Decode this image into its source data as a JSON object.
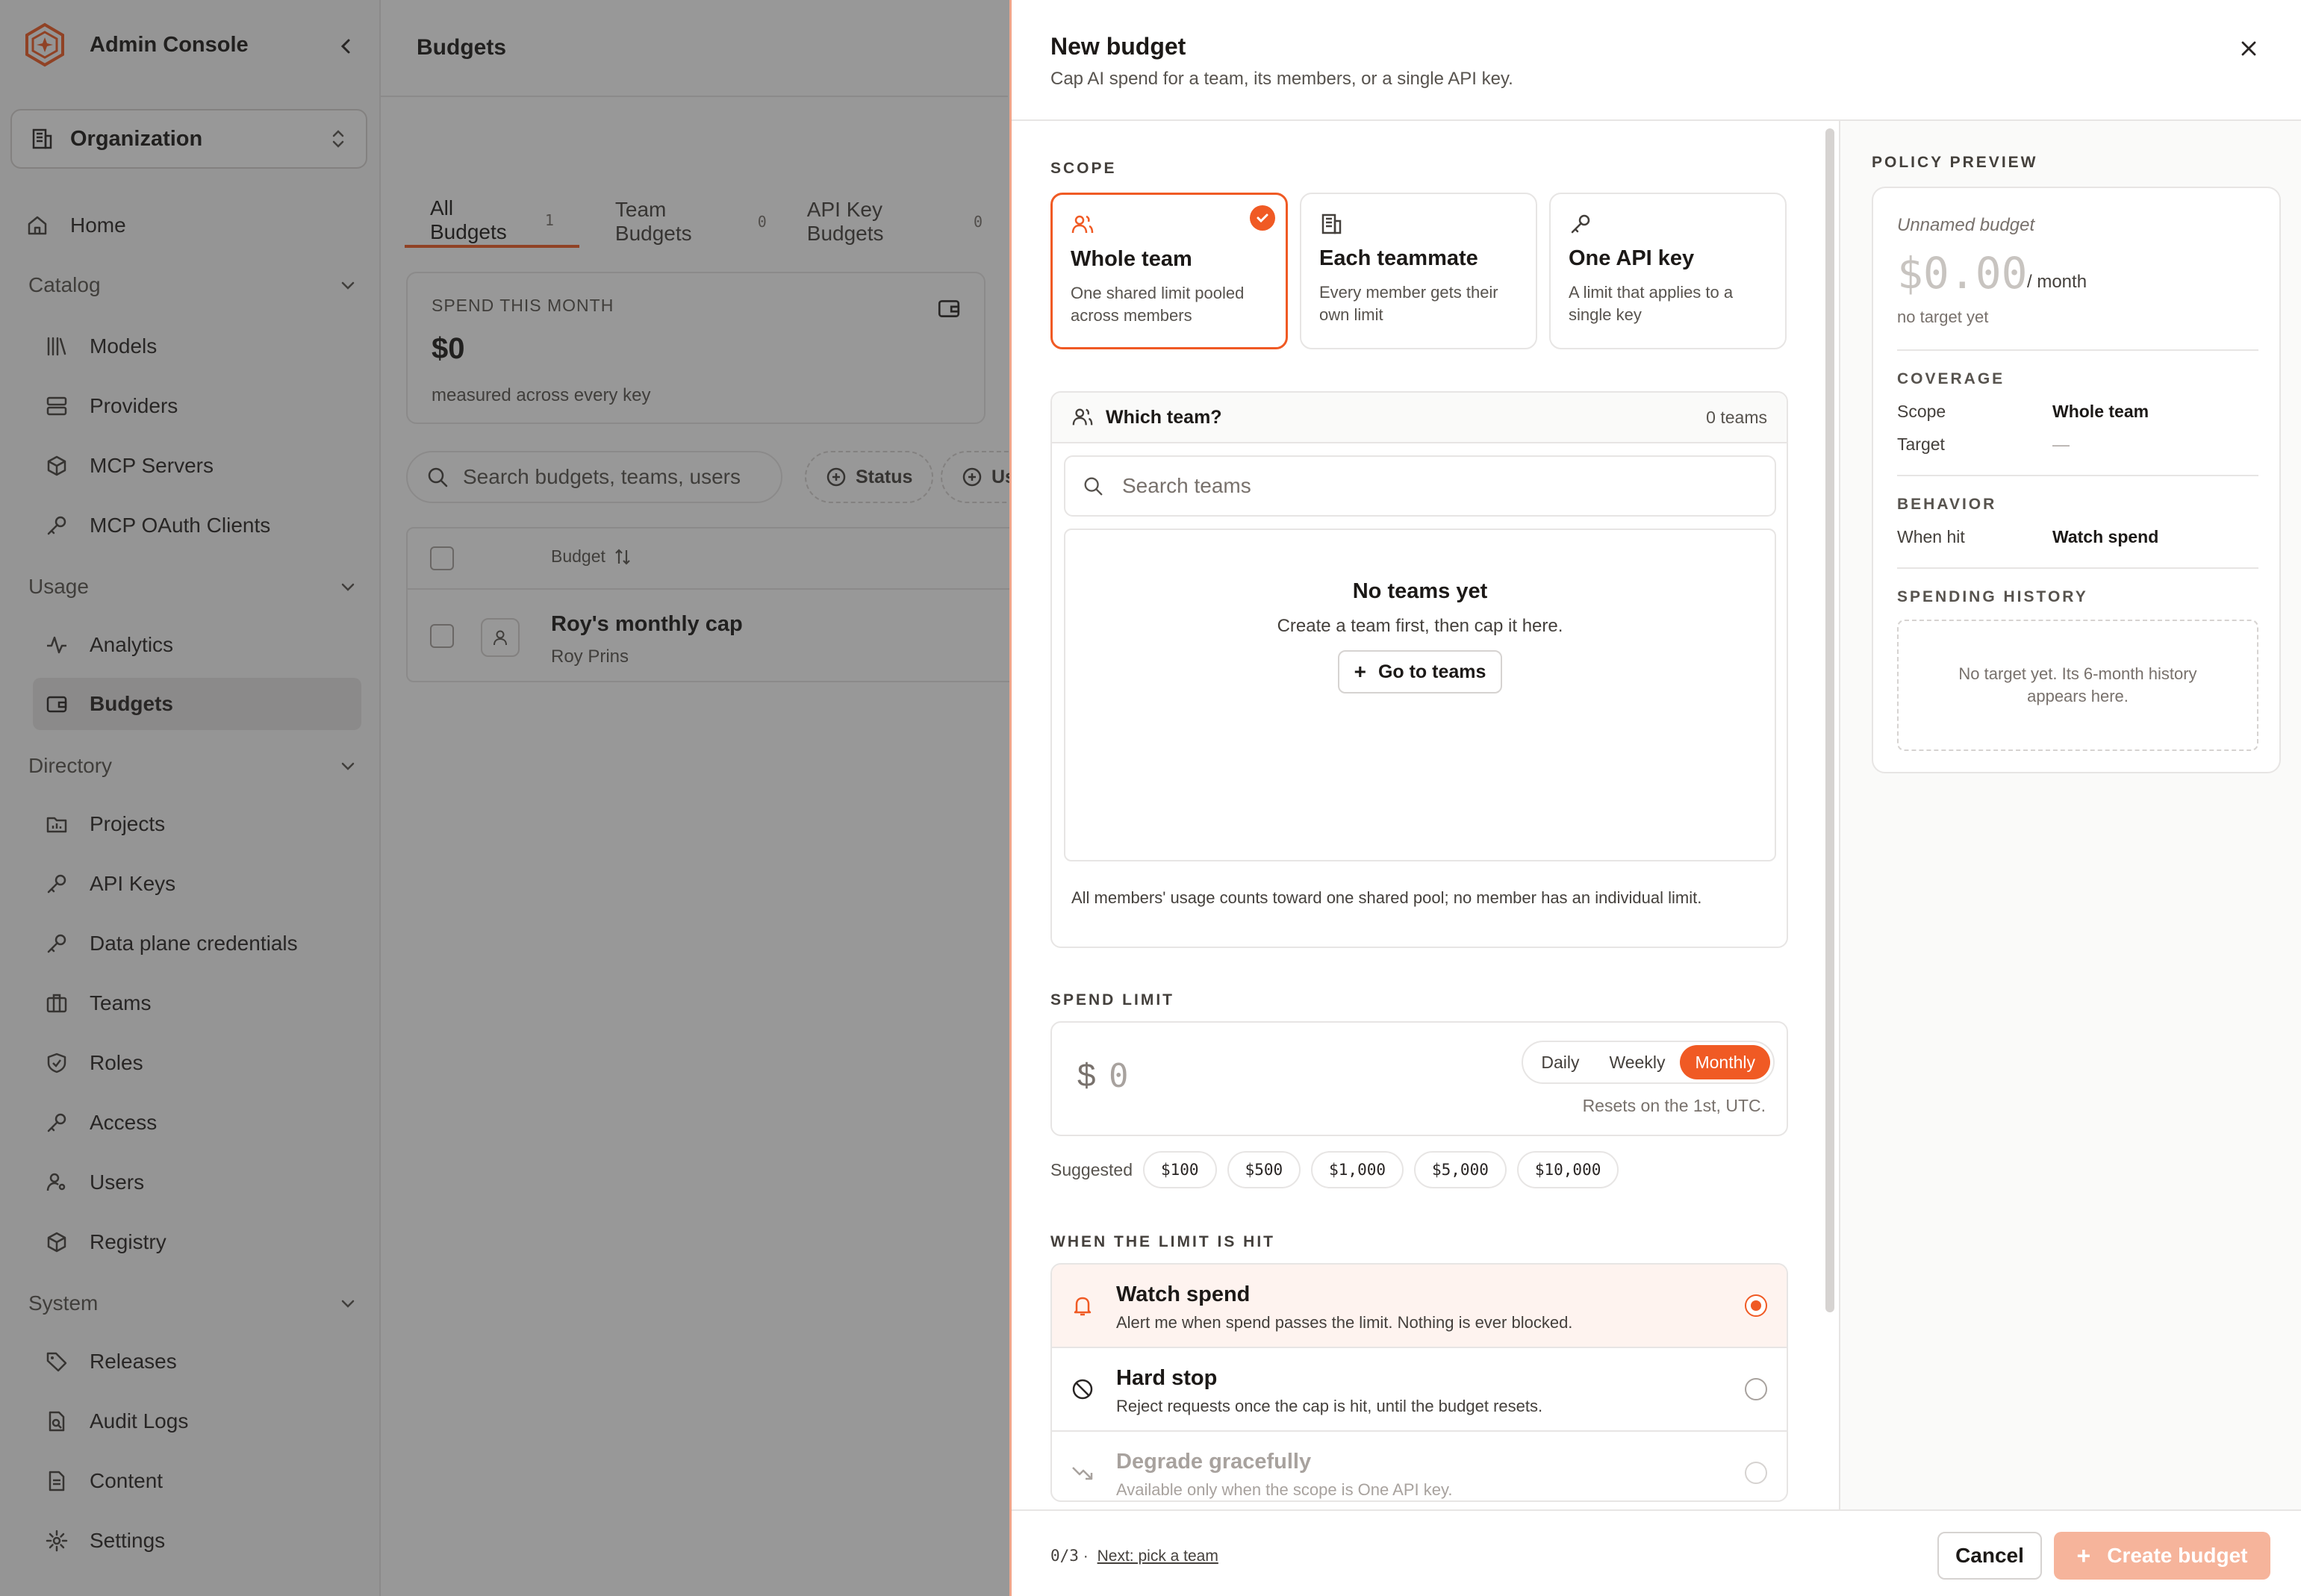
{
  "app": {
    "title": "Admin Console",
    "accent": "#f05a24"
  },
  "org_selector": {
    "label": "Organization"
  },
  "sidebar": {
    "home": "Home",
    "sections": {
      "catalog": "Catalog",
      "usage": "Usage",
      "directory": "Directory",
      "system": "System"
    },
    "items": {
      "models": "Models",
      "providers": "Providers",
      "mcp_servers": "MCP Servers",
      "mcp_oauth": "MCP OAuth Clients",
      "analytics": "Analytics",
      "budgets": "Budgets",
      "projects": "Projects",
      "api_keys": "API Keys",
      "data_plane": "Data plane credentials",
      "teams": "Teams",
      "roles": "Roles",
      "access": "Access",
      "users": "Users",
      "registry": "Registry",
      "releases": "Releases",
      "audit_logs": "Audit Logs",
      "content": "Content",
      "settings": "Settings"
    }
  },
  "main": {
    "page_title": "Budgets",
    "tabs": [
      {
        "label": "All Budgets",
        "count": "1"
      },
      {
        "label": "Team Budgets",
        "count": "0"
      },
      {
        "label": "API Key Budgets",
        "count": "0"
      }
    ],
    "spend_card": {
      "label": "SPEND THIS MONTH",
      "value": "$0",
      "sub": "measured across every key"
    },
    "search_placeholder": "Search budgets, teams, users",
    "filters": {
      "status": "Status",
      "user": "Us"
    },
    "table": {
      "header_budget": "Budget",
      "rows": [
        {
          "name": "Roy's monthly cap",
          "owner": "Roy Prins"
        }
      ]
    }
  },
  "drawer": {
    "title": "New budget",
    "subtitle": "Cap AI spend for a team, its members, or a single API key.",
    "scope_label": "SCOPE",
    "scopes": [
      {
        "title": "Whole team",
        "desc": "One shared limit pooled across members",
        "selected": true
      },
      {
        "title": "Each teammate",
        "desc": "Every member gets their own limit",
        "selected": false
      },
      {
        "title": "One API key",
        "desc": "A limit that applies to a single key",
        "selected": false
      }
    ],
    "team_picker": {
      "title": "Which team?",
      "count": "0 teams",
      "search_placeholder": "Search teams",
      "empty_title": "No teams yet",
      "empty_desc": "Create a team first, then cap it here.",
      "empty_button": "Go to teams",
      "note": "All members' usage counts toward one shared pool; no member has an individual limit."
    },
    "spend_limit": {
      "label": "SPEND LIMIT",
      "currency": "$",
      "placeholder": "0",
      "periods": [
        "Daily",
        "Weekly",
        "Monthly"
      ],
      "selected_period": "Monthly",
      "resets": "Resets on the 1st, UTC.",
      "suggested_label": "Suggested",
      "suggestions": [
        "$100",
        "$500",
        "$1,000",
        "$5,000",
        "$10,000"
      ]
    },
    "limit_hit": {
      "label": "WHEN THE LIMIT IS HIT",
      "options": [
        {
          "title": "Watch spend",
          "desc": "Alert me when spend passes the limit. Nothing is ever blocked.",
          "selected": true
        },
        {
          "title": "Hard stop",
          "desc": "Reject requests once the cap is hit, until the budget resets.",
          "selected": false
        },
        {
          "title": "Degrade gracefully",
          "desc": "Available only when the scope is One API key.",
          "disabled": true
        }
      ]
    },
    "preview": {
      "label": "POLICY PREVIEW",
      "name": "Unnamed budget",
      "amount": "$0.00",
      "period": "/ month",
      "target_note": "no target yet",
      "coverage_label": "COVERAGE",
      "scope_key": "Scope",
      "scope_val": "Whole team",
      "target_key": "Target",
      "target_val": "—",
      "behavior_label": "BEHAVIOR",
      "when_key": "When hit",
      "when_val": "Watch spend",
      "history_label": "SPENDING HISTORY",
      "history_empty": "No target yet. Its 6-month history appears here."
    },
    "footer": {
      "progress": "0/3",
      "sep": "·",
      "next": "Next: pick a team",
      "cancel": "Cancel",
      "create": "Create budget"
    }
  }
}
